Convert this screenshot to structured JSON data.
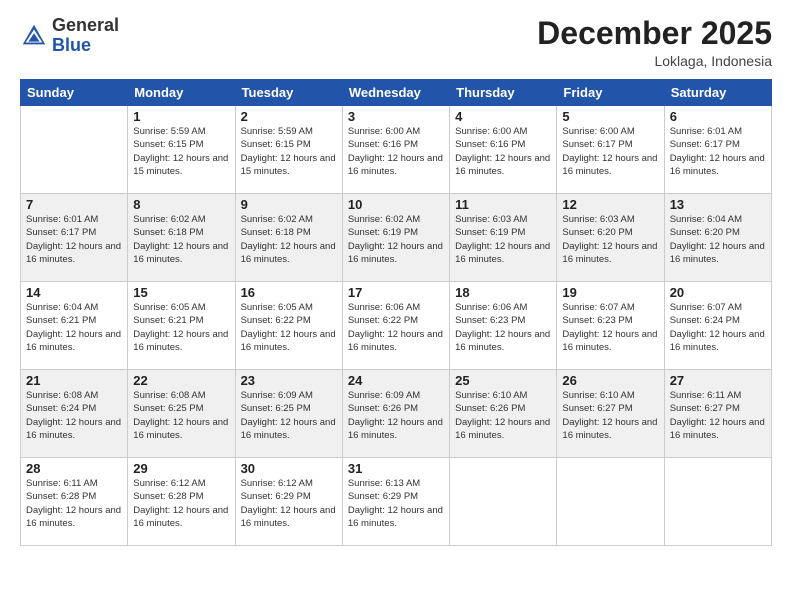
{
  "header": {
    "logo_line1": "General",
    "logo_line2": "Blue",
    "month": "December 2025",
    "location": "Loklaga, Indonesia"
  },
  "weekdays": [
    "Sunday",
    "Monday",
    "Tuesday",
    "Wednesday",
    "Thursday",
    "Friday",
    "Saturday"
  ],
  "weeks": [
    [
      {
        "day": "",
        "sunrise": "",
        "sunset": "",
        "daylight": ""
      },
      {
        "day": "1",
        "sunrise": "Sunrise: 5:59 AM",
        "sunset": "Sunset: 6:15 PM",
        "daylight": "Daylight: 12 hours and 15 minutes."
      },
      {
        "day": "2",
        "sunrise": "Sunrise: 5:59 AM",
        "sunset": "Sunset: 6:15 PM",
        "daylight": "Daylight: 12 hours and 15 minutes."
      },
      {
        "day": "3",
        "sunrise": "Sunrise: 6:00 AM",
        "sunset": "Sunset: 6:16 PM",
        "daylight": "Daylight: 12 hours and 16 minutes."
      },
      {
        "day": "4",
        "sunrise": "Sunrise: 6:00 AM",
        "sunset": "Sunset: 6:16 PM",
        "daylight": "Daylight: 12 hours and 16 minutes."
      },
      {
        "day": "5",
        "sunrise": "Sunrise: 6:00 AM",
        "sunset": "Sunset: 6:17 PM",
        "daylight": "Daylight: 12 hours and 16 minutes."
      },
      {
        "day": "6",
        "sunrise": "Sunrise: 6:01 AM",
        "sunset": "Sunset: 6:17 PM",
        "daylight": "Daylight: 12 hours and 16 minutes."
      }
    ],
    [
      {
        "day": "7",
        "sunrise": "Sunrise: 6:01 AM",
        "sunset": "Sunset: 6:17 PM",
        "daylight": "Daylight: 12 hours and 16 minutes."
      },
      {
        "day": "8",
        "sunrise": "Sunrise: 6:02 AM",
        "sunset": "Sunset: 6:18 PM",
        "daylight": "Daylight: 12 hours and 16 minutes."
      },
      {
        "day": "9",
        "sunrise": "Sunrise: 6:02 AM",
        "sunset": "Sunset: 6:18 PM",
        "daylight": "Daylight: 12 hours and 16 minutes."
      },
      {
        "day": "10",
        "sunrise": "Sunrise: 6:02 AM",
        "sunset": "Sunset: 6:19 PM",
        "daylight": "Daylight: 12 hours and 16 minutes."
      },
      {
        "day": "11",
        "sunrise": "Sunrise: 6:03 AM",
        "sunset": "Sunset: 6:19 PM",
        "daylight": "Daylight: 12 hours and 16 minutes."
      },
      {
        "day": "12",
        "sunrise": "Sunrise: 6:03 AM",
        "sunset": "Sunset: 6:20 PM",
        "daylight": "Daylight: 12 hours and 16 minutes."
      },
      {
        "day": "13",
        "sunrise": "Sunrise: 6:04 AM",
        "sunset": "Sunset: 6:20 PM",
        "daylight": "Daylight: 12 hours and 16 minutes."
      }
    ],
    [
      {
        "day": "14",
        "sunrise": "Sunrise: 6:04 AM",
        "sunset": "Sunset: 6:21 PM",
        "daylight": "Daylight: 12 hours and 16 minutes."
      },
      {
        "day": "15",
        "sunrise": "Sunrise: 6:05 AM",
        "sunset": "Sunset: 6:21 PM",
        "daylight": "Daylight: 12 hours and 16 minutes."
      },
      {
        "day": "16",
        "sunrise": "Sunrise: 6:05 AM",
        "sunset": "Sunset: 6:22 PM",
        "daylight": "Daylight: 12 hours and 16 minutes."
      },
      {
        "day": "17",
        "sunrise": "Sunrise: 6:06 AM",
        "sunset": "Sunset: 6:22 PM",
        "daylight": "Daylight: 12 hours and 16 minutes."
      },
      {
        "day": "18",
        "sunrise": "Sunrise: 6:06 AM",
        "sunset": "Sunset: 6:23 PM",
        "daylight": "Daylight: 12 hours and 16 minutes."
      },
      {
        "day": "19",
        "sunrise": "Sunrise: 6:07 AM",
        "sunset": "Sunset: 6:23 PM",
        "daylight": "Daylight: 12 hours and 16 minutes."
      },
      {
        "day": "20",
        "sunrise": "Sunrise: 6:07 AM",
        "sunset": "Sunset: 6:24 PM",
        "daylight": "Daylight: 12 hours and 16 minutes."
      }
    ],
    [
      {
        "day": "21",
        "sunrise": "Sunrise: 6:08 AM",
        "sunset": "Sunset: 6:24 PM",
        "daylight": "Daylight: 12 hours and 16 minutes."
      },
      {
        "day": "22",
        "sunrise": "Sunrise: 6:08 AM",
        "sunset": "Sunset: 6:25 PM",
        "daylight": "Daylight: 12 hours and 16 minutes."
      },
      {
        "day": "23",
        "sunrise": "Sunrise: 6:09 AM",
        "sunset": "Sunset: 6:25 PM",
        "daylight": "Daylight: 12 hours and 16 minutes."
      },
      {
        "day": "24",
        "sunrise": "Sunrise: 6:09 AM",
        "sunset": "Sunset: 6:26 PM",
        "daylight": "Daylight: 12 hours and 16 minutes."
      },
      {
        "day": "25",
        "sunrise": "Sunrise: 6:10 AM",
        "sunset": "Sunset: 6:26 PM",
        "daylight": "Daylight: 12 hours and 16 minutes."
      },
      {
        "day": "26",
        "sunrise": "Sunrise: 6:10 AM",
        "sunset": "Sunset: 6:27 PM",
        "daylight": "Daylight: 12 hours and 16 minutes."
      },
      {
        "day": "27",
        "sunrise": "Sunrise: 6:11 AM",
        "sunset": "Sunset: 6:27 PM",
        "daylight": "Daylight: 12 hours and 16 minutes."
      }
    ],
    [
      {
        "day": "28",
        "sunrise": "Sunrise: 6:11 AM",
        "sunset": "Sunset: 6:28 PM",
        "daylight": "Daylight: 12 hours and 16 minutes."
      },
      {
        "day": "29",
        "sunrise": "Sunrise: 6:12 AM",
        "sunset": "Sunset: 6:28 PM",
        "daylight": "Daylight: 12 hours and 16 minutes."
      },
      {
        "day": "30",
        "sunrise": "Sunrise: 6:12 AM",
        "sunset": "Sunset: 6:29 PM",
        "daylight": "Daylight: 12 hours and 16 minutes."
      },
      {
        "day": "31",
        "sunrise": "Sunrise: 6:13 AM",
        "sunset": "Sunset: 6:29 PM",
        "daylight": "Daylight: 12 hours and 16 minutes."
      },
      {
        "day": "",
        "sunrise": "",
        "sunset": "",
        "daylight": ""
      },
      {
        "day": "",
        "sunrise": "",
        "sunset": "",
        "daylight": ""
      },
      {
        "day": "",
        "sunrise": "",
        "sunset": "",
        "daylight": ""
      }
    ]
  ],
  "shading": [
    false,
    true,
    false,
    true,
    false
  ]
}
